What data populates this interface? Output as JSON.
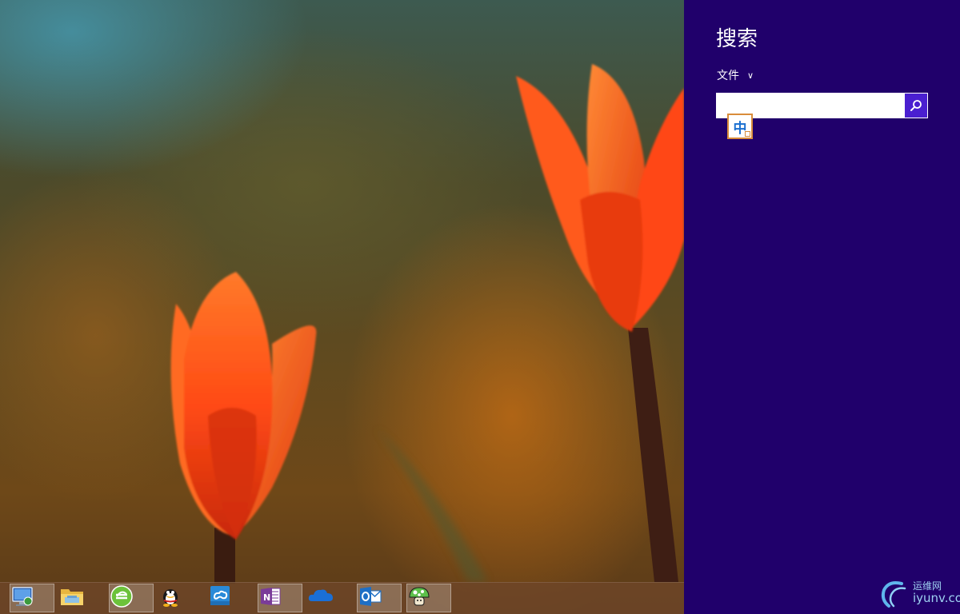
{
  "wallpaper": {
    "description_icon": "tulip-wallpaper"
  },
  "charm": {
    "title": "搜索",
    "scope_label": "文件",
    "scope_chevron": "∨",
    "search": {
      "value": "",
      "placeholder": ""
    },
    "ime_indicator": "中",
    "background_color": "#20006b"
  },
  "taskbar": {
    "items": [
      {
        "icon": "computer-icon",
        "active": true
      },
      {
        "icon": "file-explorer-icon",
        "active": false
      },
      {
        "icon": "browser-icon",
        "active": true
      },
      {
        "icon": "qq-icon",
        "active": false
      },
      {
        "icon": "cloud-sync-icon",
        "active": false
      },
      {
        "icon": "onenote-icon",
        "active": true
      },
      {
        "icon": "onedrive-icon",
        "active": false
      },
      {
        "icon": "outlook-icon",
        "active": true
      },
      {
        "icon": "mushroom-app-icon",
        "active": true
      }
    ]
  },
  "watermark": {
    "cn": "运维网",
    "en": "iyunv.com"
  }
}
